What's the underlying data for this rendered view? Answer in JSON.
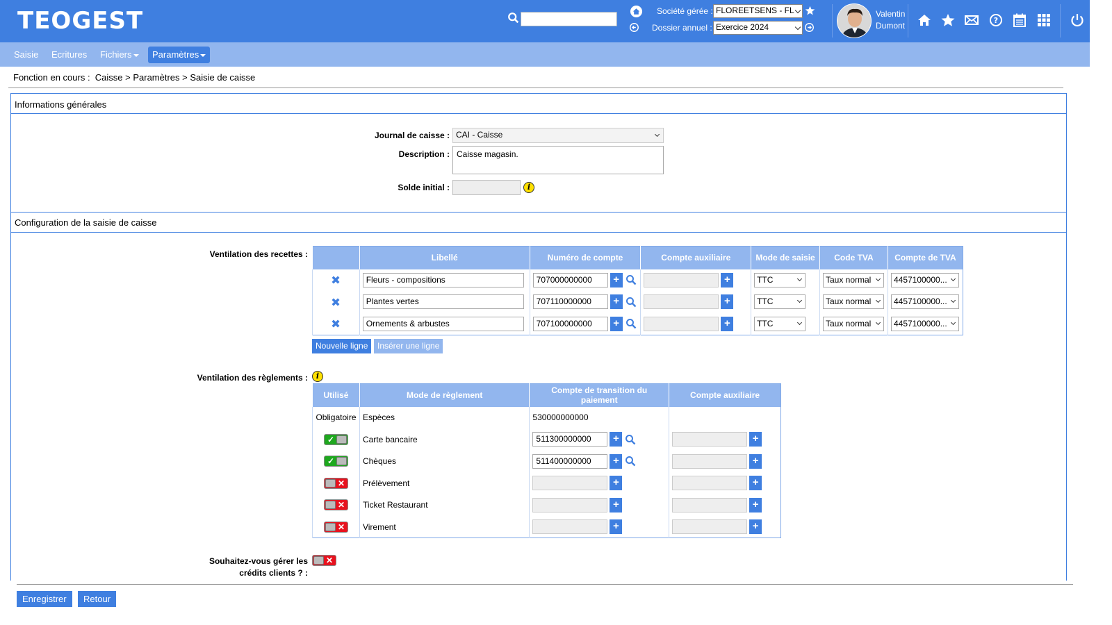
{
  "header": {
    "logo": "TEOGEST",
    "search_value": "",
    "societe_label": "Société gérée :",
    "societe_value": "FLOREETSENS - FL",
    "dossier_label": "Dossier annuel :",
    "dossier_value": "Exercice 2024",
    "user_first": "Valentin",
    "user_last": "Dumont"
  },
  "menu": {
    "items": [
      "Saisie",
      "Ecritures",
      "Fichiers",
      "Paramètres"
    ]
  },
  "breadcrumb": "Fonction en cours :  Caisse > Paramètres > Saisie de caisse",
  "general": {
    "title": "Informations générales",
    "journal_label": "Journal de caisse :",
    "journal_value": "CAI - Caisse",
    "description_label": "Description :",
    "description_value": "Caisse magasin.",
    "solde_label": "Solde initial :",
    "solde_value": ""
  },
  "config": {
    "title": "Configuration de la saisie de caisse",
    "recettes_label": "Ventilation des recettes :",
    "recettes_headers": [
      "",
      "Libellé",
      "Numéro de compte",
      "Compte auxiliaire",
      "Mode de saisie",
      "Code TVA",
      "Compte de TVA"
    ],
    "recettes": [
      {
        "libelle": "Fleurs - compositions",
        "compte": "707000000000",
        "aux": "",
        "mode": "TTC",
        "code_tva": "Taux normal",
        "compte_tva": "4457100000..."
      },
      {
        "libelle": "Plantes vertes",
        "compte": "707110000000",
        "aux": "",
        "mode": "TTC",
        "code_tva": "Taux normal",
        "compte_tva": "4457100000..."
      },
      {
        "libelle": "Ornements & arbustes",
        "compte": "707100000000",
        "aux": "",
        "mode": "TTC",
        "code_tva": "Taux normal",
        "compte_tva": "4457100000..."
      }
    ],
    "nouvelle_ligne": "Nouvelle ligne",
    "inserer_ligne": "Insérer une ligne",
    "reglements_label": "Ventilation des règlements :",
    "reglements_headers": [
      "Utilisé",
      "Mode de règlement",
      "Compte de transition du paiement",
      "Compte auxiliaire"
    ],
    "reglements": [
      {
        "utilise": "Obligatoire",
        "mode": "Espèces",
        "compte": "530000000000",
        "enabled": null
      },
      {
        "utilise": "",
        "mode": "Carte bancaire",
        "compte": "511300000000",
        "enabled": true
      },
      {
        "utilise": "",
        "mode": "Chèques",
        "compte": "511400000000",
        "enabled": true
      },
      {
        "utilise": "",
        "mode": "Prélèvement",
        "compte": "",
        "enabled": false
      },
      {
        "utilise": "",
        "mode": "Ticket Restaurant",
        "compte": "",
        "enabled": false
      },
      {
        "utilise": "",
        "mode": "Virement",
        "compte": "",
        "enabled": false
      }
    ],
    "credits_label_1": "Souhaitez-vous gérer les",
    "credits_label_2": "crédits clients ? :",
    "credits_enabled": false
  },
  "footer": {
    "save": "Enregistrer",
    "back": "Retour"
  },
  "colors": {
    "primary": "#3f7fe0",
    "light": "#92b6ee"
  }
}
